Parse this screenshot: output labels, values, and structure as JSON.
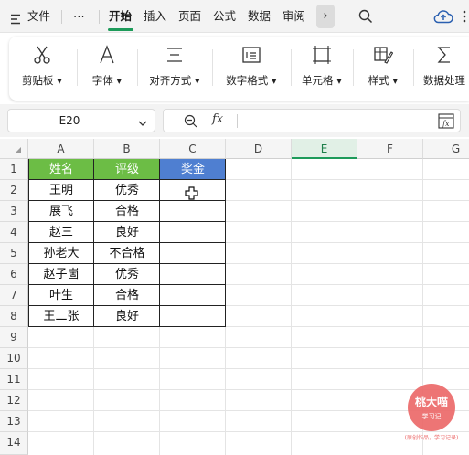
{
  "menubar": {
    "file_label": "文件",
    "more_label": "⋯",
    "tabs": [
      {
        "label": "开始"
      },
      {
        "label": "插入"
      },
      {
        "label": "页面"
      },
      {
        "label": "公式"
      },
      {
        "label": "数据"
      },
      {
        "label": "审阅"
      }
    ],
    "next_symbol": "›",
    "active_tab": "开始",
    "accent_color": "#1d9b5a"
  },
  "ribbon": {
    "groups": [
      {
        "label": "剪贴板 ▾",
        "icon": "scissors-icon"
      },
      {
        "label": "字体 ▾",
        "icon": "font-icon"
      },
      {
        "label": "对齐方式 ▾",
        "icon": "align-icon"
      },
      {
        "label": "数字格式 ▾",
        "icon": "number-format-icon"
      },
      {
        "label": "单元格 ▾",
        "icon": "cell-icon"
      },
      {
        "label": "样式 ▾",
        "icon": "style-icon"
      },
      {
        "label": "数据处理",
        "icon": "sum-icon"
      }
    ]
  },
  "formula_bar": {
    "cell_ref": "E20",
    "fx_label": "fx",
    "formula_value": ""
  },
  "sheet": {
    "columns": [
      "A",
      "B",
      "C",
      "D",
      "E",
      "F",
      "G"
    ],
    "selected_column": "E",
    "rows": [
      "1",
      "2",
      "3",
      "4",
      "5",
      "6",
      "7",
      "8",
      "9",
      "10",
      "11",
      "12",
      "13",
      "14"
    ],
    "header_row": [
      "姓名",
      "评级",
      "奖金"
    ],
    "header_colors": {
      "A": "#6cbd45",
      "B": "#6cbd45",
      "C": "#4f7fd1"
    },
    "data": [
      [
        "王明",
        "优秀",
        ""
      ],
      [
        "展飞",
        "合格",
        ""
      ],
      [
        "赵三",
        "良好",
        ""
      ],
      [
        "孙老大",
        "不合格",
        ""
      ],
      [
        "赵子崮",
        "优秀",
        ""
      ],
      [
        "叶生",
        "合格",
        ""
      ],
      [
        "王二张",
        "良好",
        ""
      ]
    ]
  },
  "watermark": {
    "title": "桃大喵",
    "subtitle": "学习记",
    "tagline": "(原创作品，学习记录)"
  }
}
